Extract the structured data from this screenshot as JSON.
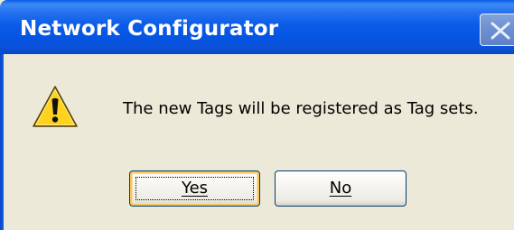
{
  "window": {
    "title": "Network Configurator"
  },
  "dialog": {
    "icon": "warning-icon",
    "message": "The new Tags will be registered as Tag sets.",
    "yes_label": "Yes",
    "no_label": "No"
  },
  "colors": {
    "titlebar": "#0654e2",
    "dialog_background": "#ece9d8",
    "default_button_highlight": "#f7c658",
    "button_border": "#003c74",
    "warning_yellow": "#ffd21e"
  }
}
